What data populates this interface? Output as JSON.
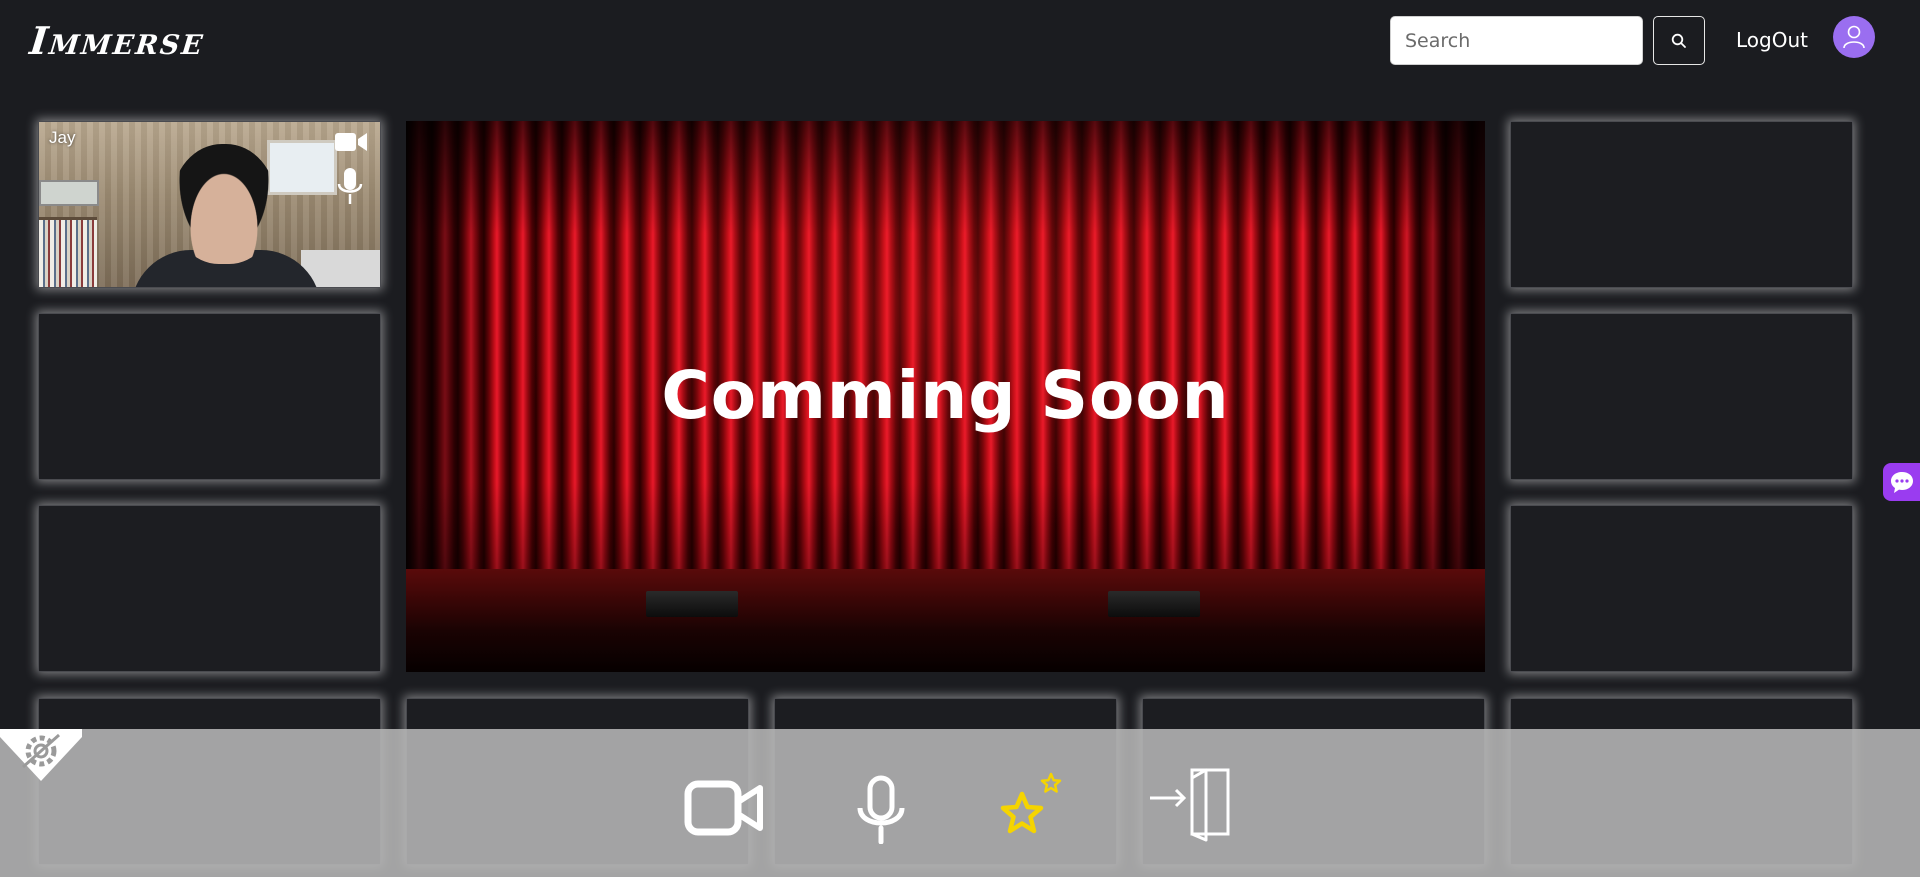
{
  "app": {
    "logo_text": "Immerse"
  },
  "header": {
    "search_placeholder": "Search",
    "logout_label": "LogOut"
  },
  "participants": [
    {
      "name": "Jay",
      "camera": "on",
      "mic": "on"
    }
  ],
  "stage": {
    "title": "Comming Soon"
  },
  "toolbar": {
    "buttons": [
      {
        "icon": "video-camera-icon"
      },
      {
        "icon": "microphone-icon"
      },
      {
        "icon": "stars-icon"
      },
      {
        "icon": "exit-door-icon"
      }
    ]
  },
  "colors": {
    "background": "#1b1c20",
    "accent_purple": "#9a6ef0",
    "chat_purple": "#9a3cf0",
    "star_yellow": "#f5d400",
    "toolbar": "#b6b6b6"
  }
}
